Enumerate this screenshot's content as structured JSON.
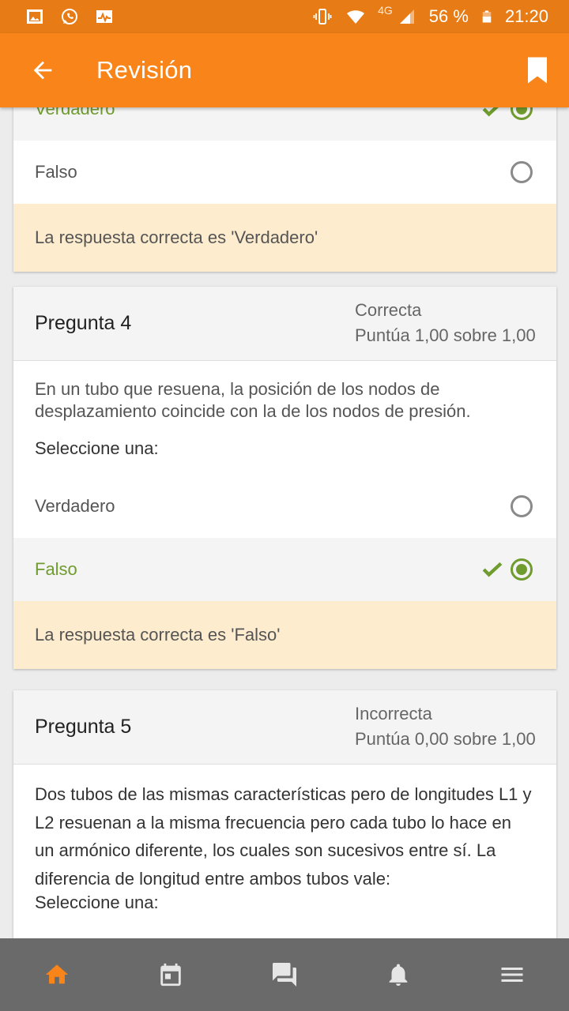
{
  "status_bar": {
    "network": "4G",
    "battery": "56 %",
    "time": "21:20"
  },
  "app_bar": {
    "title": "Revisión"
  },
  "prev_question": {
    "options": [
      {
        "label": "Verdadero",
        "selected": true,
        "correct": true
      },
      {
        "label": "Falso",
        "selected": false
      }
    ],
    "feedback": "La respuesta correcta es 'Verdadero'"
  },
  "question4": {
    "title": "Pregunta 4",
    "status": "Correcta",
    "score": "Puntúa 1,00 sobre 1,00",
    "text": "En un tubo que resuena, la posición de los nodos de desplazamiento coincide con la de los nodos de presión.",
    "prompt": "Seleccione una:",
    "options": [
      {
        "label": "Verdadero",
        "selected": false
      },
      {
        "label": "Falso",
        "selected": true,
        "correct": true
      }
    ],
    "feedback": "La respuesta correcta es 'Falso'"
  },
  "question5": {
    "title": "Pregunta 5",
    "status": "Incorrecta",
    "score": "Puntúa 0,00 sobre 1,00",
    "text": "Dos tubos de las mismas características pero de longitudes L1 y L2 resuenan a la misma frecuencia pero cada tubo lo hace en un armónico diferente, los cuales son sucesivos entre sí. La diferencia de longitud entre ambos tubos vale:",
    "prompt": "Seleccione una:"
  },
  "colors": {
    "primary": "#f98419",
    "status_bar": "#e77b15",
    "correct": "#6f9b2f",
    "feedback_bg": "#fdecce",
    "nav_bg": "#6a6a6a"
  },
  "bottom_nav": {
    "items": [
      {
        "icon": "home-icon",
        "active": true
      },
      {
        "icon": "calendar-icon",
        "active": false
      },
      {
        "icon": "messages-icon",
        "active": false
      },
      {
        "icon": "bell-icon",
        "active": false
      },
      {
        "icon": "menu-icon",
        "active": false
      }
    ]
  }
}
